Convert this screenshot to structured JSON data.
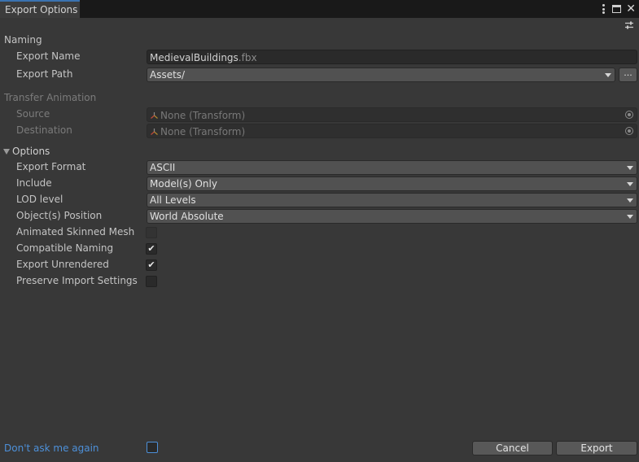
{
  "window": {
    "title": "Export Options"
  },
  "sections": {
    "naming": "Naming",
    "transfer_animation": "Transfer Animation",
    "options": "Options"
  },
  "naming": {
    "export_name_label": "Export Name",
    "export_name_value": "MedievalBuildings",
    "export_name_ext": ".fbx",
    "export_path_label": "Export Path",
    "export_path_value": "Assets/",
    "browse_label": "..."
  },
  "transfer": {
    "source_label": "Source",
    "source_value": "None (Transform)",
    "destination_label": "Destination",
    "destination_value": "None (Transform)"
  },
  "options": {
    "export_format_label": "Export Format",
    "export_format_value": "ASCII",
    "include_label": "Include",
    "include_value": "Model(s) Only",
    "lod_label": "LOD level",
    "lod_value": "All Levels",
    "position_label": "Object(s) Position",
    "position_value": "World Absolute",
    "animated_skinned_label": "Animated Skinned Mesh",
    "animated_skinned_checked": false,
    "compatible_naming_label": "Compatible Naming",
    "compatible_naming_checked": true,
    "export_unrendered_label": "Export Unrendered",
    "export_unrendered_checked": true,
    "preserve_import_label": "Preserve Import Settings",
    "preserve_import_checked": false
  },
  "footer": {
    "dont_ask_label": "Don't ask me again",
    "dont_ask_checked": false,
    "cancel_label": "Cancel",
    "export_label": "Export"
  },
  "icons": {
    "check_glyph": "✔",
    "close_glyph": "✕"
  },
  "colors": {
    "accent": "#4d90d9",
    "background": "#383838",
    "titlebar": "#191919"
  }
}
